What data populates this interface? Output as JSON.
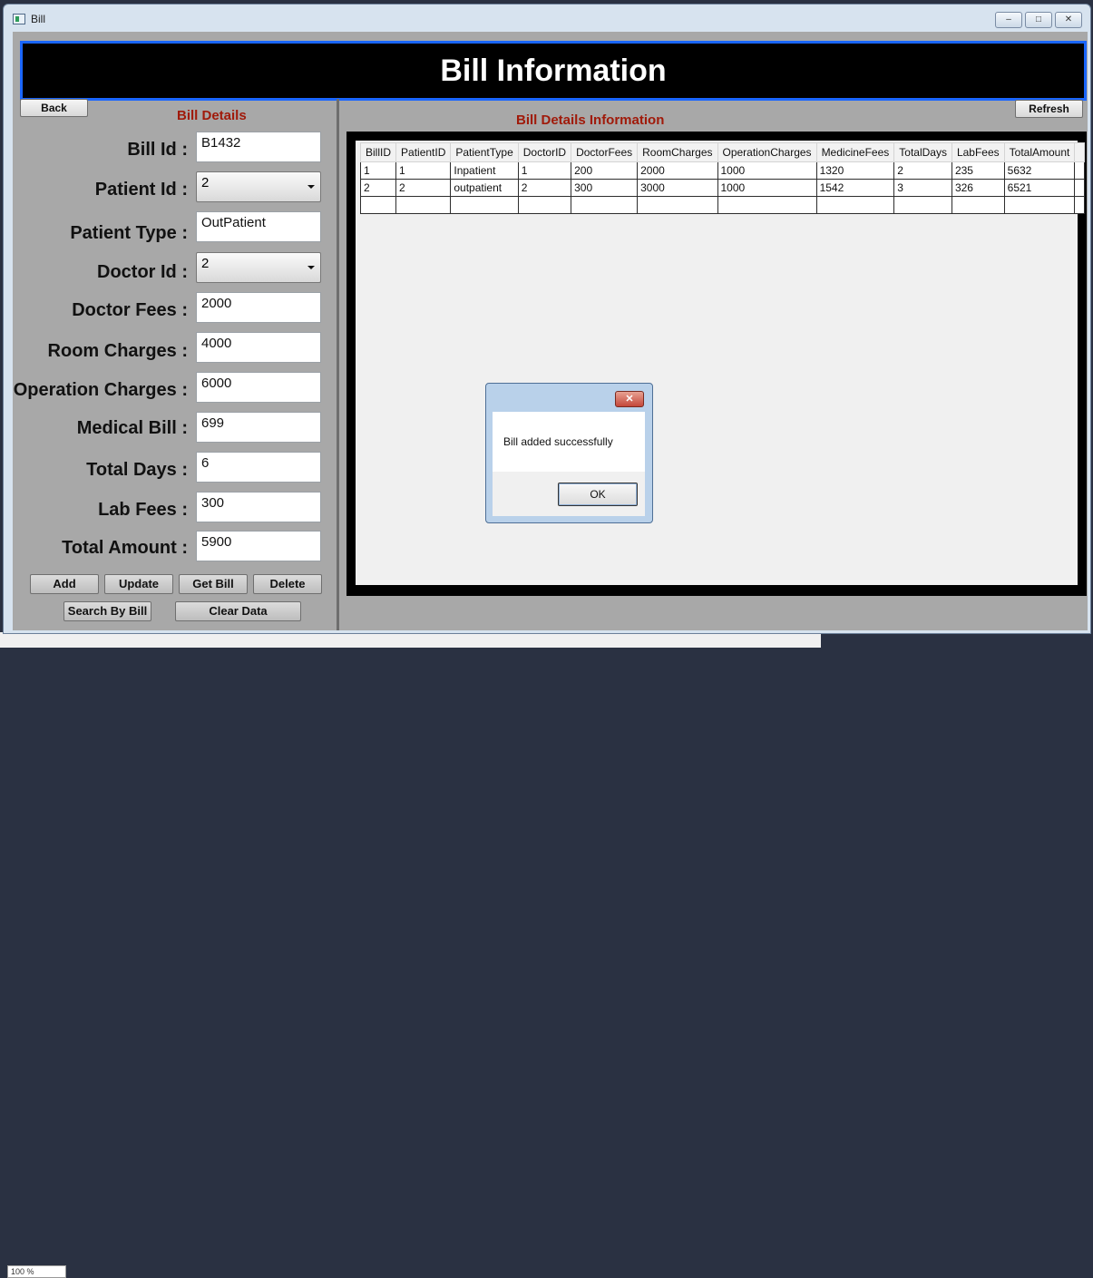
{
  "window": {
    "title": "Bill",
    "controls": {
      "minimize": "–",
      "maximize": "□",
      "close": "✕"
    }
  },
  "header": {
    "title": "Bill Information"
  },
  "toolbar": {
    "back_label": "Back",
    "refresh_label": "Refresh"
  },
  "left": {
    "section_title": "Bill Details",
    "fields": {
      "bill_id": {
        "label": "Bill Id :",
        "value": "B1432"
      },
      "patient_id": {
        "label": "Patient Id :",
        "value": "2"
      },
      "patient_type": {
        "label": "Patient Type :",
        "value": "OutPatient"
      },
      "doctor_id": {
        "label": "Doctor Id :",
        "value": "2"
      },
      "doctor_fees": {
        "label": "Doctor Fees :",
        "value": "2000"
      },
      "room_charges": {
        "label": "Room Charges :",
        "value": "4000"
      },
      "operation_charges": {
        "label": "Operation Charges :",
        "value": "6000"
      },
      "medical_bill": {
        "label": "Medical Bill :",
        "value": "699"
      },
      "total_days": {
        "label": "Total Days :",
        "value": "6"
      },
      "lab_fees": {
        "label": "Lab Fees :",
        "value": "300"
      },
      "total_amount": {
        "label": "Total Amount :",
        "value": "5900"
      }
    },
    "buttons": {
      "add": "Add",
      "update": "Update",
      "get_bill": "Get Bill",
      "delete": "Delete",
      "search_by_bill": "Search By Bill",
      "clear_data": "Clear Data"
    }
  },
  "right": {
    "section_title": "Bill Details Information",
    "table": {
      "columns": [
        "BillID",
        "PatientID",
        "PatientType",
        "DoctorID",
        "DoctorFees",
        "RoomCharges",
        "OperationCharges",
        "MedicineFees",
        "TotalDays",
        "LabFees",
        "TotalAmount"
      ],
      "rows": [
        [
          "1",
          "1",
          "Inpatient",
          "1",
          "200",
          "2000",
          "1000",
          "1320",
          "2",
          "235",
          "5632"
        ],
        [
          "2",
          "2",
          "outpatient",
          "2",
          "300",
          "3000",
          "1000",
          "1542",
          "3",
          "326",
          "6521"
        ]
      ]
    }
  },
  "dialog": {
    "close": "✕",
    "message": "Bill added successfully",
    "ok_label": "OK"
  },
  "background": {
    "zoom_text": "100 %"
  },
  "colors": {
    "header_bg": "#000000",
    "header_border": "#1a66ff",
    "section_title": "#a01a0a",
    "panel_bg": "#a8a8a8"
  }
}
